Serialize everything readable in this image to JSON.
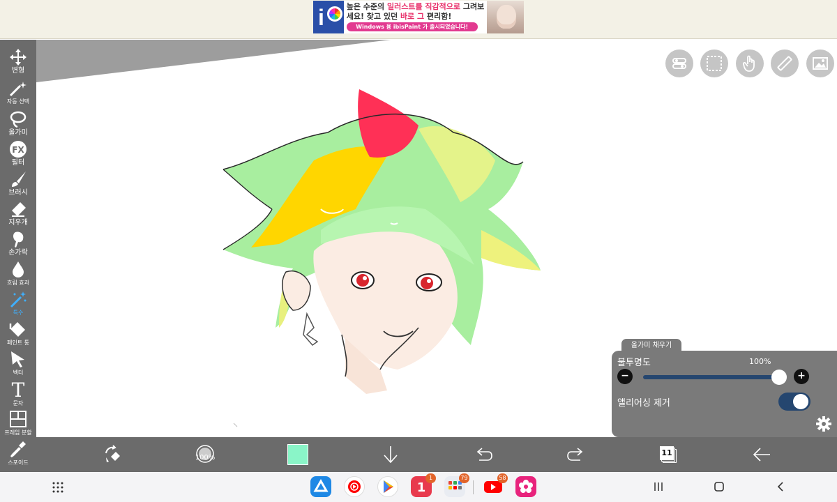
{
  "ad": {
    "line1_a": "높은 수준의 ",
    "line1_b": "일러스트를 직감적으로",
    "line1_c": " 그려보",
    "line2_a": "세요! 찾고 있던 ",
    "line2_b": "바로 그",
    "line2_c": " 편리함!",
    "pill": "Windows 용 ibisPaint 가 출시되었습니다!"
  },
  "toolbar": {
    "tools": [
      {
        "label": "변형",
        "icon": "move-icon"
      },
      {
        "label": "자동 선택",
        "icon": "magic-wand-icon"
      },
      {
        "label": "올가미",
        "icon": "lasso-icon"
      },
      {
        "label": "필터",
        "icon": "fx-icon",
        "glyph": "FX"
      },
      {
        "label": "브러시",
        "icon": "brush-icon"
      },
      {
        "label": "지우개",
        "icon": "eraser-icon"
      },
      {
        "label": "손가락",
        "icon": "smudge-icon"
      },
      {
        "label": "흐림 효과",
        "icon": "blur-drop-icon"
      },
      {
        "label": "특수",
        "icon": "special-wand-icon",
        "active": true
      },
      {
        "label": "페인트 통",
        "icon": "paint-bucket-icon"
      },
      {
        "label": "벡터",
        "icon": "vector-arrow-icon"
      },
      {
        "label": "문자",
        "icon": "text-icon",
        "glyph": "T"
      },
      {
        "label": "프레임 분할",
        "icon": "frame-divide-icon"
      },
      {
        "label": "스포이드",
        "icon": "eyedropper-icon"
      }
    ]
  },
  "panel": {
    "tab": "올가미 채우기",
    "opacity_label": "불투명도",
    "opacity_value": "100%",
    "opacity_fraction": 1.0,
    "minus": "−",
    "plus": "+",
    "antialias_label": "앨리어싱 제거",
    "antialias_on": true
  },
  "bottom": {
    "brush_size": "100%",
    "color": "#8af5c8",
    "layer_count": "11"
  },
  "nav": {
    "badges": {
      "app1": "1",
      "app2": "79",
      "youtube": "58"
    }
  },
  "colors": {
    "toolbar_bg": "#6b6b6b",
    "panel_bg": "#7a7a7a",
    "active_tool": "#3fb0ff",
    "slider": "#25466f"
  }
}
